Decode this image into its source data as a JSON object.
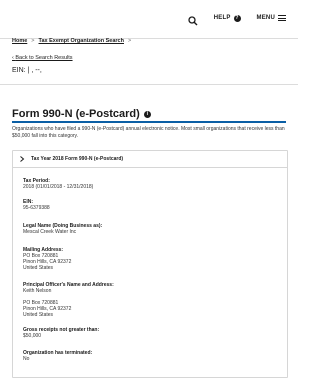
{
  "header": {
    "help_label": "HELP",
    "menu_label": "MENU"
  },
  "breadcrumb": {
    "home": "Home",
    "search": "Tax Exempt Organization Search"
  },
  "back_link": "Back to Search Results",
  "ein_line": "EIN: | , --,",
  "form": {
    "title": "Form 990-N (e-Postcard)",
    "intro": "Organizations who have filed a 990-N (e-Postcard) annual electronic notice. Most small organizations that receive less than $50,000 fall into this category."
  },
  "accordion": {
    "header": "Tax Year 2018 Form 990-N (e-Postcard)",
    "tax_period": {
      "label": "Tax Period:",
      "value": "2018 (01/01/2018 - 12/31/2018)"
    },
    "ein": {
      "label": "EIN:",
      "value": "95-6379388"
    },
    "legal_name": {
      "label": "Legal Name (Doing Business as):",
      "value": "Mescal Creek Water Inc"
    },
    "mailing_address": {
      "label": "Mailing Address:",
      "line1": "PO Box 720881",
      "line2": "Pinon Hills, CA 92372",
      "line3": "United States"
    },
    "principal_officer": {
      "label": "Principal Officer's Name and Address:",
      "name": "Keith Nelson",
      "line1": "PO Box 720881",
      "line2": "Pinon Hills, CA 92372",
      "line3": "United States"
    },
    "gross_receipts": {
      "label": "Gross receipts not greater than:",
      "value": "$50,000"
    },
    "terminated": {
      "label": "Organization has terminated:",
      "value": "No"
    }
  }
}
